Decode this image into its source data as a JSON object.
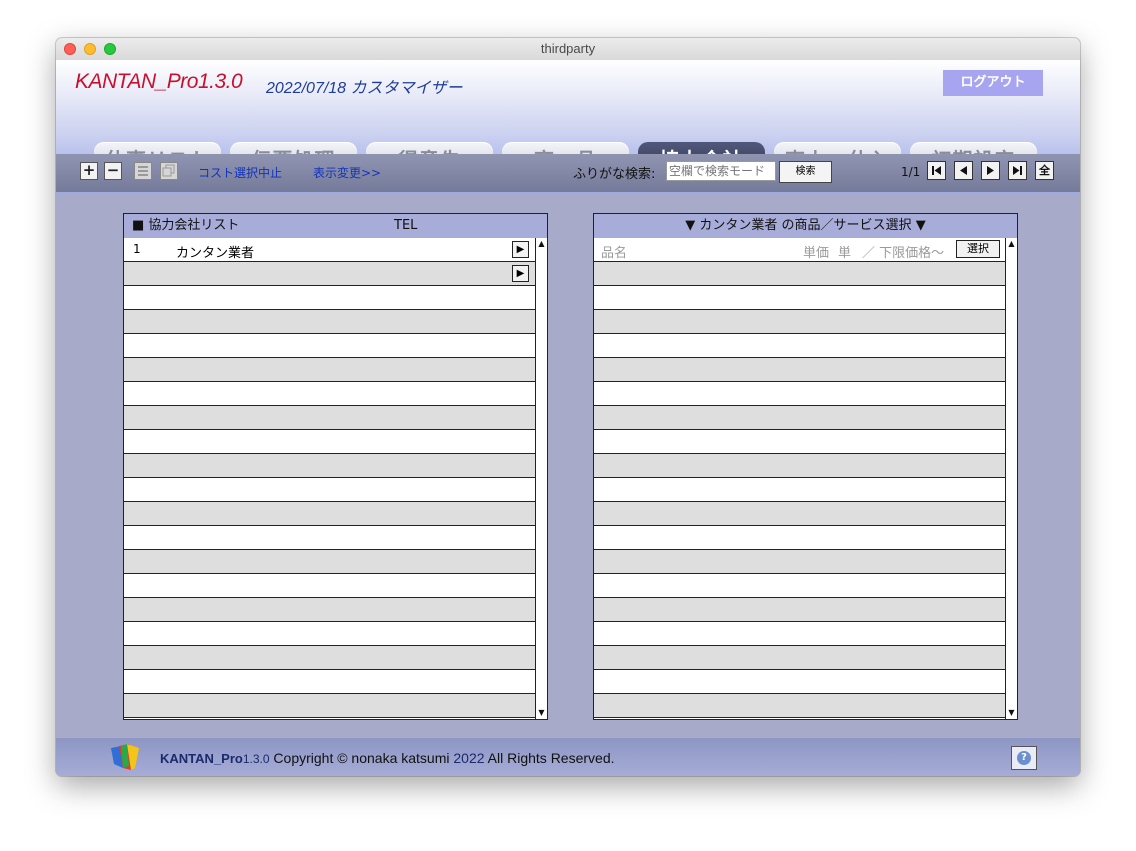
{
  "window": {
    "title": "thirdparty"
  },
  "header": {
    "app_name": "KANTAN_Pro1.3.0",
    "app_sub": "2022/07/18 カスタマイザー",
    "logout_label": "ログアウト"
  },
  "tabs": [
    {
      "label": "仕事リスト",
      "active": false
    },
    {
      "label": "伝票処理",
      "active": false
    },
    {
      "label": "得意先",
      "active": false
    },
    {
      "label": "商　品",
      "active": false
    },
    {
      "label": "協力会社",
      "active": true
    },
    {
      "label": "売上・仕入",
      "active": false
    },
    {
      "label": "初期設定",
      "active": false
    }
  ],
  "toolbar": {
    "add_icon": "+",
    "remove_icon": "−",
    "cost_cancel_label": "コスト選択中止",
    "display_change_label": "表示変更>>",
    "search_label": "ふりがな検索:",
    "search_placeholder": "空欄で検索モード",
    "search_button": "検索",
    "page_count": "1/1",
    "first_icon": "⏮",
    "prev_icon": "◀",
    "next_icon": "▶",
    "last_icon": "⏭",
    "all_label": "全"
  },
  "left_panel": {
    "title": "■ 協力会社リスト",
    "col_tel": "TEL",
    "rows": [
      {
        "num": "1",
        "name": "カンタン業者"
      }
    ]
  },
  "right_panel": {
    "title": "▼ カンタン業者 の商品／サービス選択 ▼",
    "col_name": "品名",
    "col_price": "単価",
    "col_unit": "単",
    "col_lower": "／ 下限価格〜",
    "select_button": "選択"
  },
  "footer": {
    "app": "KANTAN_Pro",
    "version": "1.3.0",
    "copyright": "Copyright © nonaka katsumi",
    "year": "2022",
    "rights": "All Rights Reserved.",
    "help_icon": "?"
  }
}
